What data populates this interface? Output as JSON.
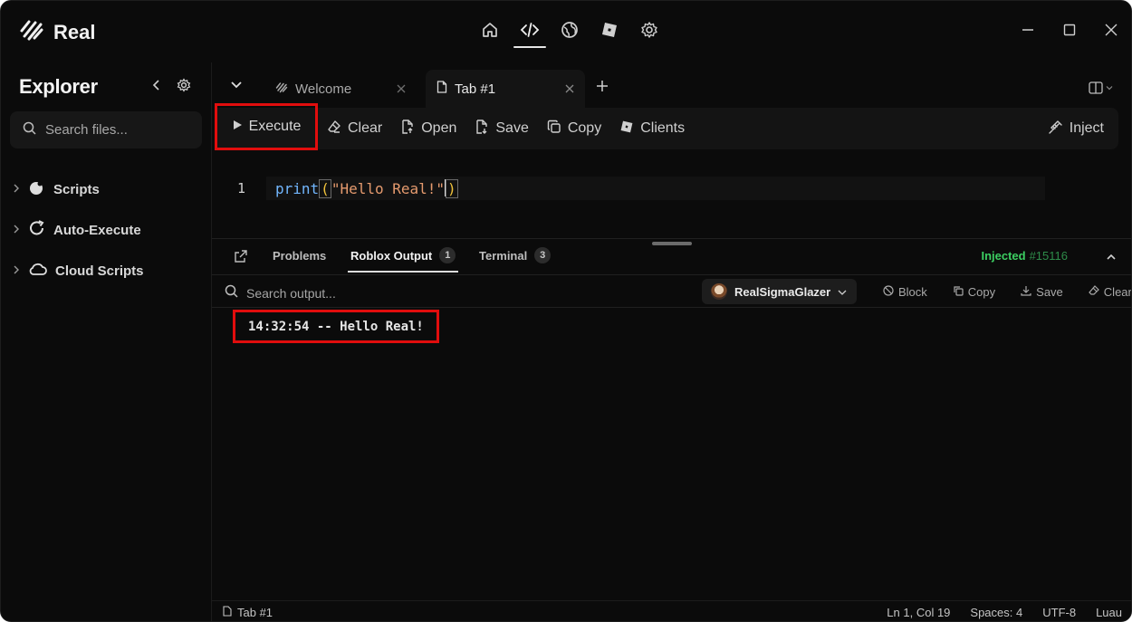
{
  "app": {
    "name": "Real"
  },
  "nav": {
    "items": [
      "home-icon",
      "code-icon",
      "globe-icon",
      "roblox-icon",
      "settings-icon"
    ],
    "active": "code-icon"
  },
  "sidebar": {
    "title": "Explorer",
    "search_placeholder": "Search files...",
    "items": [
      {
        "label": "Scripts",
        "icon": "scripts-icon"
      },
      {
        "label": "Auto-Execute",
        "icon": "refresh-icon"
      },
      {
        "label": "Cloud Scripts",
        "icon": "cloud-icon"
      }
    ]
  },
  "tabs": [
    {
      "label": "Welcome",
      "active": false
    },
    {
      "label": "Tab #1",
      "active": true
    }
  ],
  "toolbar": {
    "execute": "Execute",
    "clear": "Clear",
    "open": "Open",
    "save": "Save",
    "copy": "Copy",
    "clients": "Clients",
    "inject": "Inject"
  },
  "editor": {
    "line_number": "1",
    "fn": "print",
    "open_paren": "(",
    "string": "\"Hello Real!\"",
    "close_paren": ")"
  },
  "panel": {
    "tabs": [
      {
        "label": "Problems",
        "count": null
      },
      {
        "label": "Roblox Output",
        "count": "1"
      },
      {
        "label": "Terminal",
        "count": "3"
      }
    ],
    "status": "Injected",
    "process_id": "#15116",
    "search_placeholder": "Search output...",
    "user": "RealSigmaGlazer",
    "tools": {
      "block": "Block",
      "copy": "Copy",
      "save": "Save",
      "clear": "Clear"
    },
    "log_line": "14:32:54 -- Hello Real!"
  },
  "statusbar": {
    "file": "Tab #1",
    "position": "Ln 1, Col 19",
    "spaces": "Spaces: 4",
    "encoding": "UTF-8",
    "language": "Luau"
  },
  "colors": {
    "accent_green": "#3ccf62",
    "highlight_red": "#e10d0d",
    "background": "#0b0b0b"
  }
}
